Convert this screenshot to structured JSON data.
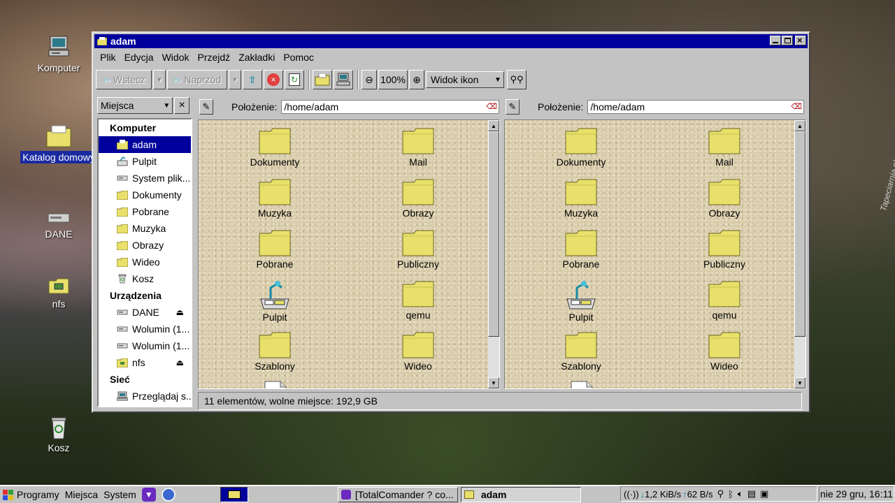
{
  "desktop": {
    "icons": [
      {
        "label": "Komputer"
      },
      {
        "label": "Katalog domowy"
      },
      {
        "label": "DANE"
      },
      {
        "label": "nfs"
      },
      {
        "label": "Kosz"
      }
    ],
    "watermark": "Tapeciarnia.pl"
  },
  "window": {
    "title": "adam",
    "menu": [
      "Plik",
      "Edycja",
      "Widok",
      "Przejdź",
      "Zakładki",
      "Pomoc"
    ],
    "toolbar": {
      "back_label": "Wstecz",
      "forward_label": "Naprzód",
      "zoom_value": "100%",
      "view_mode": "Widok ikon"
    },
    "sidebar": {
      "selector_label": "Miejsca",
      "sections": [
        {
          "title": "Komputer",
          "items": [
            "adam",
            "Pulpit",
            "System plik...",
            "Dokumenty",
            "Pobrane",
            "Muzyka",
            "Obrazy",
            "Wideo",
            "Kosz"
          ]
        },
        {
          "title": "Urządzenia",
          "items": [
            "DANE",
            "Wolumin (1...",
            "Wolumin (1...",
            "nfs"
          ]
        },
        {
          "title": "Sieć",
          "items": [
            "Przeglądaj s..."
          ]
        }
      ]
    },
    "panes": [
      {
        "location_label": "Położenie:",
        "location_value": "/home/adam",
        "items": [
          "Dokumenty",
          "Mail",
          "Muzyka",
          "Obrazy",
          "Pobrane",
          "Publiczny",
          "Pulpit",
          "qemu",
          "Szablony",
          "Wideo"
        ]
      },
      {
        "location_label": "Położenie:",
        "location_value": "/home/adam",
        "items": [
          "Dokumenty",
          "Mail",
          "Muzyka",
          "Obrazy",
          "Pobrane",
          "Publiczny",
          "Pulpit",
          "qemu",
          "Szablony",
          "Wideo"
        ]
      }
    ],
    "status": "11 elementów, wolne miejsce: 192,9 GB"
  },
  "taskbar": {
    "menu": [
      "Programy",
      "Miejsca",
      "System"
    ],
    "tasks": [
      "[TotalComander ? co...",
      "adam"
    ],
    "tray": {
      "down_rate": "1,2 KiB/s",
      "up_rate": "62 B/s"
    },
    "clock": "nie 29 gru, 16:11"
  },
  "colors": {
    "titlebar": "#00009c",
    "chrome": "#c3c3c3",
    "folder": "#e8e06a"
  }
}
